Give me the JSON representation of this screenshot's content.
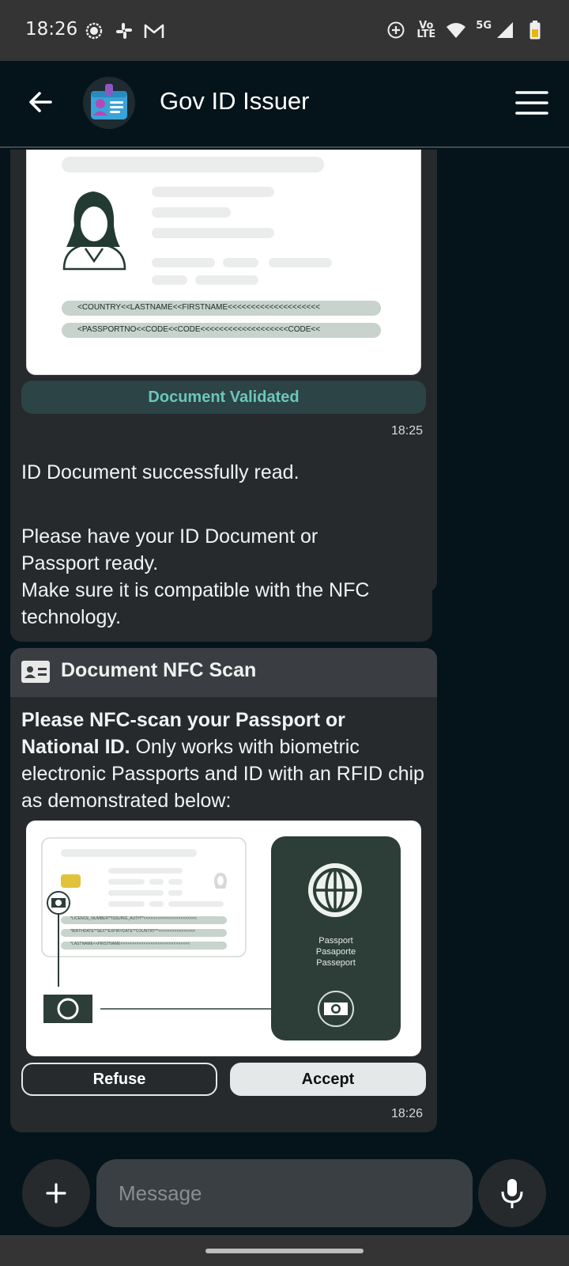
{
  "status_bar": {
    "time": "18:26",
    "left_icons": [
      "chat-bubble-icon",
      "slack-icon",
      "gmail-icon"
    ],
    "right_icons": [
      "data-saver-icon",
      "volte-icon",
      "wifi-icon",
      "signal-icon",
      "battery-icon"
    ],
    "network_volte": "Vo LTE",
    "network_5g": "5G"
  },
  "app_bar": {
    "title": "Gov ID Issuer",
    "back_icon": "arrow-left-icon",
    "menu_icon": "hamburger-menu-icon",
    "avatar_icon": "id-card-avatar-icon"
  },
  "messages": {
    "validated_doc": {
      "mrz_line1": "<COUNTRY<<LASTNAME<<FIRSTNAME<<<<<<<<<<<<<<<<<<<<",
      "mrz_line2": "<PASSPORTNO<<CODE<<CODE<<<<<<<<<<<<<<<<<<<CODE<<",
      "status_label": "Document Validated",
      "time": "18:25"
    },
    "read_success": {
      "text": "ID Document successfully read."
    },
    "prepare": {
      "line1": "Please have your ID Document or",
      "line2": "Passport ready.",
      "line3": "Make sure it is compatible with the NFC",
      "line4": "technology."
    },
    "nfc_scan": {
      "header_icon": "id-card-icon",
      "title": "Document NFC Scan",
      "body_bold": "Please NFC-scan your Passport or National ID.",
      "body_rest": " Only works with biometric electronic Passports and ID with an RFID chip as demonstrated below:",
      "illustration": {
        "id_mrz_1": "*LICENCE_NUMBER**ISSUING_AUTH**<<<<<<<<<<<<<<<<<<<<<<<",
        "id_mrz_2": "*BIRTHDATE**SEX**EXPIRYDATE**COUNTRY**<<<<<<<<<<<<<<<<",
        "id_mrz_3": "*LASTNAME<<FIRSTNAME<<<<<<<<<<<<<<<<<<<<<<<<<<<<<<",
        "passport_word_1": "Passport",
        "passport_word_2": "Pasaporte",
        "passport_word_3": "Passeport"
      },
      "refuse_label": "Refuse",
      "accept_label": "Accept",
      "time": "18:26"
    }
  },
  "composer": {
    "placeholder": "Message",
    "add_icon": "plus-icon",
    "mic_icon": "microphone-icon"
  },
  "colors": {
    "background": "#04141a",
    "bubble": "#262a2d",
    "accent_teal": "#6cc6bd",
    "illustration_dark": "#2c3e37"
  }
}
